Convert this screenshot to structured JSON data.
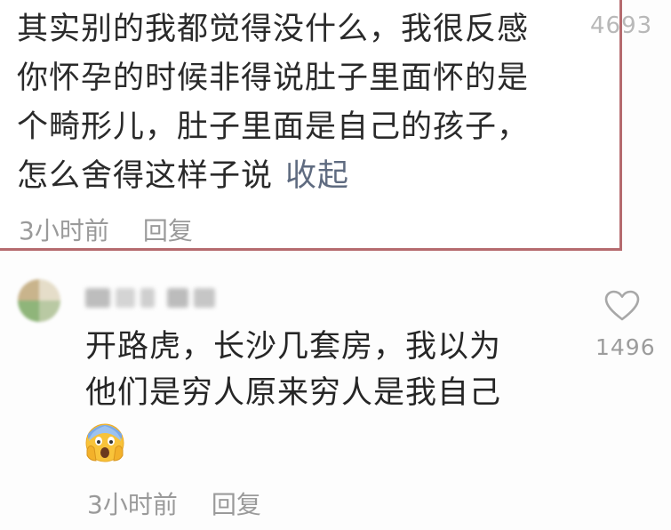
{
  "comments": [
    {
      "text_lines": [
        "其实别的我都觉得没什么，我很反感",
        "你怀孕的时候非得说肚子里面怀的是",
        "个畸形儿，肚子里面是自己的孩子，",
        "怎么舍得这样子说"
      ],
      "collapse_label": "收起",
      "time": "3小时前",
      "reply_label": "回复",
      "likes": "4693"
    },
    {
      "text_lines": [
        "开路虎，长沙几套房，我以为",
        "他们是穷人原来穷人是我自己"
      ],
      "emoji": "scream-face-icon",
      "time": "3小时前",
      "reply_label": "回复",
      "likes": "1496",
      "like_icon": "heart-outline-icon"
    }
  ],
  "colors": {
    "highlight_border": "#b56a6e",
    "link": "#5f6b80",
    "meta_text": "#9a9a9a"
  }
}
